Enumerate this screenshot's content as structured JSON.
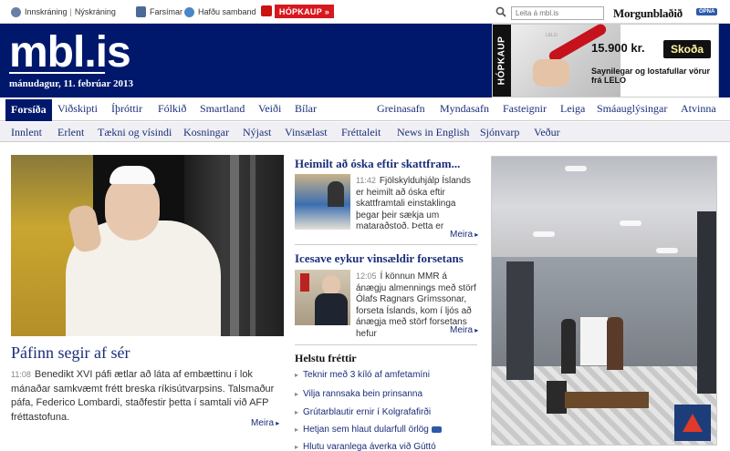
{
  "topbar": {
    "login": "Innskráning",
    "register": "Nýskráning",
    "mobile": "Farsímar",
    "contact": "Hafðu samband",
    "hopkaup": "HÓPKAUP",
    "search_placeholder": "Leita á mbl.is",
    "newspaper_logo": "Morgunblaðið",
    "newspaper_badge": "OPNA"
  },
  "header": {
    "logo": "mbl.is",
    "date": "mánudagur, 11. febrúar 2013"
  },
  "ad": {
    "side_label": "HÓPKAUP",
    "price": "15.900 kr.",
    "button": "Skoða",
    "text": "Saynilegar og lostafullar vörur frá LELO",
    "product_mini": "LELO"
  },
  "nav_primary": {
    "active": "Forsíða",
    "items": [
      "Viðskipti",
      "Íþróttir",
      "Fólkið",
      "Smartland",
      "Veiði",
      "Bílar"
    ],
    "right_items": [
      "Greinasafn",
      "Myndasafn",
      "Fasteignir",
      "Leiga",
      "Smáauglýsingar",
      "Atvinna"
    ]
  },
  "nav_secondary": {
    "items": [
      "Innlent",
      "Erlent",
      "Tækni og vísindi",
      "Kosningar",
      "Nýjast",
      "Vinsælast",
      "Fréttaleit",
      "News in English",
      "Sjónvarp",
      "Veður"
    ]
  },
  "lead": {
    "title": "Páfinn segir af sér",
    "time": "11:08",
    "body": "Benedikt XVI páfi ætlar að láta af embættinu í lok mánaðar samkvæmt frétt breska ríkisútvarpsins. Talsmaður páfa, Federico Lombardi, staðfestir þetta í samtali við AFP fréttastofuna.",
    "more": "Meira"
  },
  "stories": [
    {
      "title": "Heimilt að óska eftir skattfram...",
      "time": "11:42",
      "snippet": "Fjölskylduhjálp Íslands er heimilt að óska eftir skattframtali einstaklinga þegar þeir sækja um mataraðstoð. Þetta er",
      "more": "Meira"
    },
    {
      "title": "Icesave eykur vinsældir forsetans",
      "time": "12:05",
      "snippet": "Í könnun MMR á ánægju almennings með störf Ólafs Ragnars Grímssonar, forseta Íslands, kom í ljós að ánægja með störf forsetans hefur",
      "more": "Meira"
    }
  ],
  "top_news": {
    "heading": "Helstu fréttir",
    "items": [
      "Teknir með 3 kíló af amfetamíni",
      "Vilja rannsaka bein prinsanna",
      "Grútarblautir ernir í Kolgrafafirði",
      "Hetjan sem hlaut dularfull örlög",
      "Hlutu varanlega áverka við Gúttó"
    ]
  }
}
